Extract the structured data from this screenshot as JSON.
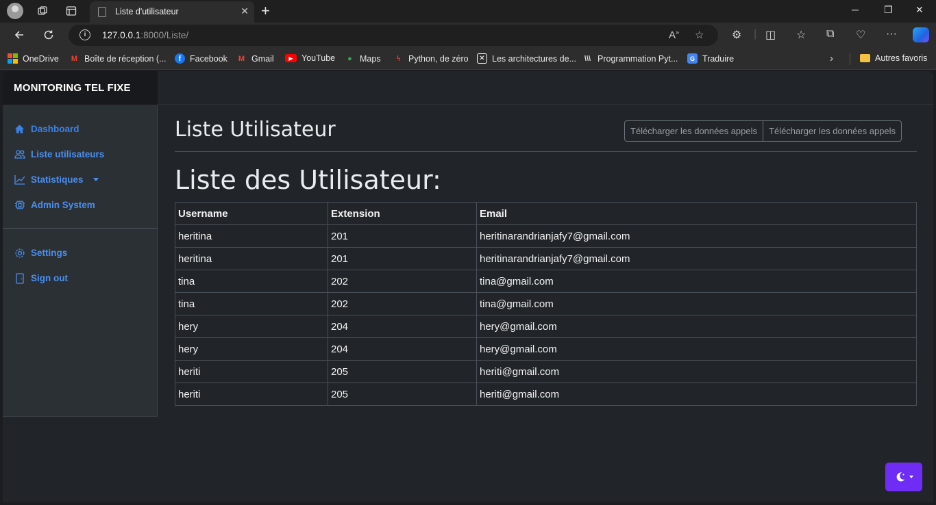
{
  "browser": {
    "tab_title": "Liste d'utilisateur",
    "tab_close": "✕",
    "new_tab": "+",
    "url_host": "127.0.0.1",
    "url_rest": ":8000/Liste/",
    "window_controls": [
      "─",
      "❐",
      "✕"
    ]
  },
  "bookmarks": [
    {
      "label": "OneDrive",
      "icon": "windows-icon"
    },
    {
      "label": "Boîte de réception (...",
      "icon": "gmail-icon"
    },
    {
      "label": "Facebook",
      "icon": "facebook-icon"
    },
    {
      "label": "Gmail",
      "icon": "gmail-icon"
    },
    {
      "label": "YouTube",
      "icon": "youtube-icon"
    },
    {
      "label": "Maps",
      "icon": "maps-icon"
    },
    {
      "label": "Python, de zéro",
      "icon": "python-icon"
    },
    {
      "label": "Les architectures de...",
      "icon": "arch-icon"
    },
    {
      "label": "Programmation Pyt...",
      "icon": "prog-icon"
    },
    {
      "label": "Traduire",
      "icon": "translate-icon"
    },
    {
      "label": "Autres favoris",
      "icon": "folder-icon"
    }
  ],
  "app": {
    "brand": "MONITORING TEL FIXE",
    "nav": [
      {
        "label": "Dashboard",
        "icon": "home-icon"
      },
      {
        "label": "Liste utilisateurs",
        "icon": "users-icon"
      },
      {
        "label": "Statistiques",
        "icon": "chart-line-icon"
      },
      {
        "label": "Admin System",
        "icon": "cpu-icon"
      }
    ],
    "nav_bottom": [
      {
        "label": "Settings",
        "icon": "gear-icon"
      },
      {
        "label": "Sign out",
        "icon": "door-icon"
      }
    ],
    "page_title": "Liste Utilisateur",
    "buttons": [
      "Télécharger les données appels",
      "Télécharger les données appels"
    ],
    "heading": "Liste des Utilisateur:",
    "table": {
      "headers": [
        "Username",
        "Extension",
        "Email"
      ],
      "rows": [
        [
          "heritina",
          "201",
          "heritinarandrianjafy7@gmail.com"
        ],
        [
          "heritina",
          "201",
          "heritinarandrianjafy7@gmail.com"
        ],
        [
          "tina",
          "202",
          "tina@gmail.com"
        ],
        [
          "tina",
          "202",
          "tina@gmail.com"
        ],
        [
          "hery",
          "204",
          "hery@gmail.com"
        ],
        [
          "hery",
          "204",
          "hery@gmail.com"
        ],
        [
          "heriti",
          "205",
          "heriti@gmail.com"
        ],
        [
          "heriti",
          "205",
          "heriti@gmail.com"
        ]
      ]
    }
  },
  "colors": {
    "accent": "#4a8ff0",
    "theme_button": "#6f2cf5",
    "page_bg": "#212529",
    "sidebar_bg": "#2b3035"
  }
}
